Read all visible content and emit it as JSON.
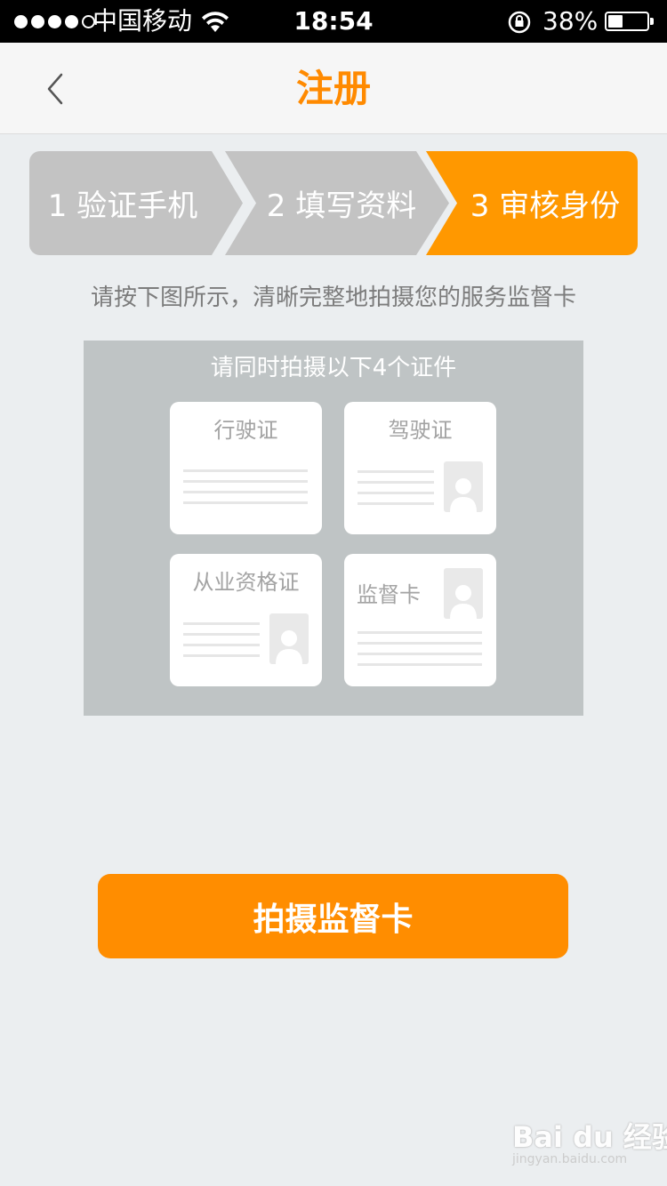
{
  "status_bar": {
    "carrier": "中国移动",
    "time": "18:54",
    "battery_percent": "38%",
    "battery_level": 0.38,
    "signal_bars_filled": 4,
    "signal_bars_total": 5
  },
  "nav": {
    "title": "注册",
    "back_icon": "chevron-left-icon"
  },
  "steps": [
    {
      "label": "1 验证手机",
      "active": false
    },
    {
      "label": "2 填写资料",
      "active": false
    },
    {
      "label": "3 审核身份",
      "active": true
    }
  ],
  "instruction": "请按下图所示，清晰完整地拍摄您的服务监督卡",
  "illustration": {
    "title": "请同时拍摄以下4个证件",
    "cards": [
      {
        "label": "行驶证"
      },
      {
        "label": "驾驶证"
      },
      {
        "label": "从业资格证"
      },
      {
        "label": "监督卡"
      }
    ]
  },
  "action_button": "拍摄监督卡",
  "watermark": {
    "brand": "Bai du 经验",
    "url": "jingyan.baidu.com"
  },
  "colors": {
    "accent": "#ff8a00",
    "step_active": "#ff9800",
    "step_inactive": "#c3c3c3",
    "panel": "#bfc4c5",
    "background": "#ebeef0"
  }
}
